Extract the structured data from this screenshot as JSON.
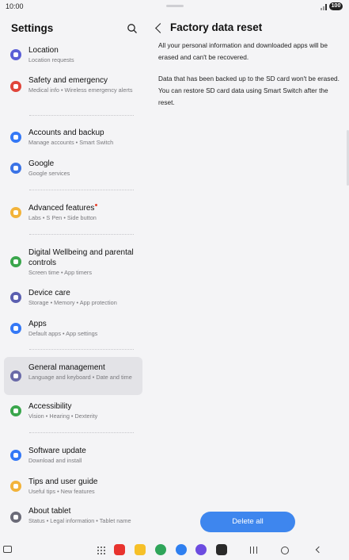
{
  "status_bar": {
    "time": "10:00",
    "battery": "100"
  },
  "left_pane": {
    "title": "Settings",
    "items": [
      {
        "title": "Location",
        "sub": "Location requests",
        "color": "#5b5fd6",
        "icon": "location-icon"
      },
      {
        "title": "Safety and emergency",
        "sub": "Medical info  •  Wireless emergency alerts",
        "color": "#e0453a",
        "icon": "safety-icon"
      },
      {
        "title": "Accounts and backup",
        "sub": "Manage accounts  •  Smart Switch",
        "color": "#3478f6",
        "icon": "accounts-icon"
      },
      {
        "title": "Google",
        "sub": "Google services",
        "color": "#3b73e6",
        "icon": "google-icon"
      },
      {
        "title": "Advanced features",
        "sub": "Labs  •  S Pen  •  Side button",
        "color": "#f2b33a",
        "icon": "advanced-features-icon"
      },
      {
        "title": "Digital Wellbeing and parental controls",
        "sub": "Screen time  •  App timers",
        "color": "#3aa64c",
        "icon": "wellbeing-icon"
      },
      {
        "title": "Device care",
        "sub": "Storage  •  Memory  •  App protection",
        "color": "#5b5fb0",
        "icon": "device-care-icon"
      },
      {
        "title": "Apps",
        "sub": "Default apps  •  App settings",
        "color": "#3478f6",
        "icon": "apps-icon"
      },
      {
        "title": "General management",
        "sub": "Language and keyboard  •  Date and time",
        "color": "#6a6aa8",
        "icon": "general-management-icon"
      },
      {
        "title": "Accessibility",
        "sub": "Vision  •  Hearing  •  Dexterity",
        "color": "#3aa64c",
        "icon": "accessibility-icon"
      },
      {
        "title": "Software update",
        "sub": "Download and install",
        "color": "#3478f6",
        "icon": "software-update-icon"
      },
      {
        "title": "Tips and user guide",
        "sub": "Useful tips  •  New features",
        "color": "#f2b33a",
        "icon": "tips-icon"
      },
      {
        "title": "About tablet",
        "sub": "Status  •  Legal information  •  Tablet name",
        "color": "#6b6b78",
        "icon": "about-icon"
      }
    ]
  },
  "right_pane": {
    "title": "Factory data reset",
    "paragraph1": "All your personal information and downloaded apps will be erased and can't be recovered.",
    "paragraph2": "Data that has been backed up to the SD card won't be erased. You can restore SD card data using Smart Switch after the reset.",
    "delete_button": "Delete all"
  },
  "dock": [
    {
      "icon": "red-app-icon",
      "color": "#e8332e"
    },
    {
      "icon": "folder-app-icon",
      "color": "#f6c028"
    },
    {
      "icon": "phone-app-icon",
      "color": "#2fa55a"
    },
    {
      "icon": "messages-app-icon",
      "color": "#2f7ff0"
    },
    {
      "icon": "internet-app-icon",
      "color": "#6c4ce0"
    },
    {
      "icon": "camera-app-icon",
      "color": "#2a2a2a"
    }
  ]
}
